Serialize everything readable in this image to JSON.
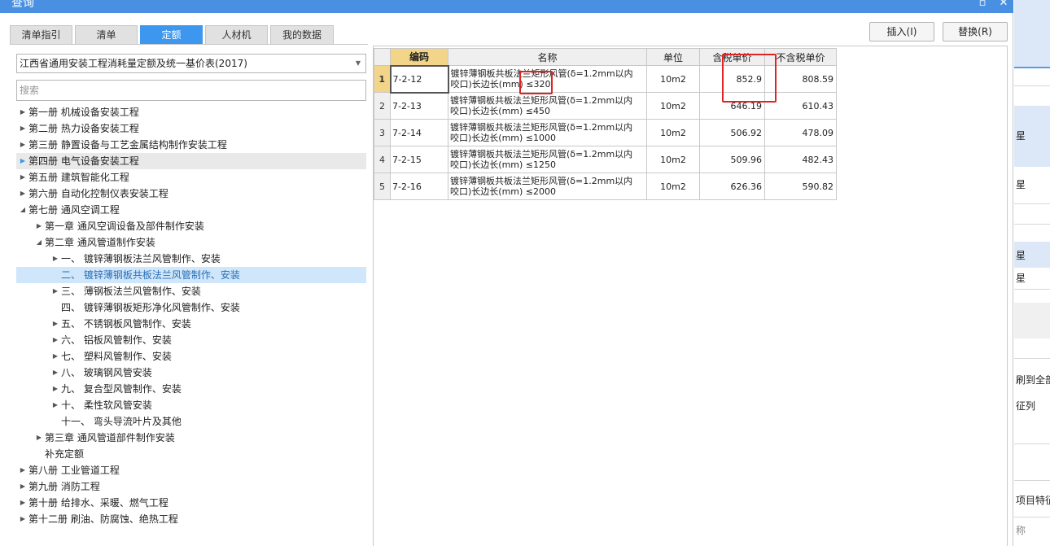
{
  "window": {
    "title": "查询",
    "maximize_glyph": "▫",
    "close_glyph": "✕"
  },
  "tabs": [
    {
      "label": "清单指引",
      "active": false
    },
    {
      "label": "清单",
      "active": false
    },
    {
      "label": "定额",
      "active": true
    },
    {
      "label": "人材机",
      "active": false
    },
    {
      "label": "我的数据",
      "active": false
    }
  ],
  "library_select": {
    "value": "江西省通用安装工程消耗量定额及统一基价表(2017)"
  },
  "search": {
    "placeholder": "搜索"
  },
  "tree": [
    {
      "label": "第一册 机械设备安装工程",
      "state": "collapsed"
    },
    {
      "label": "第二册 热力设备安装工程",
      "state": "collapsed"
    },
    {
      "label": "第三册 静置设备与工艺金属结构制作安装工程",
      "state": "collapsed"
    },
    {
      "label": "第四册 电气设备安装工程",
      "state": "collapsed"
    },
    {
      "label": "第五册 建筑智能化工程",
      "state": "collapsed"
    },
    {
      "label": "第六册 自动化控制仪表安装工程",
      "state": "collapsed"
    },
    {
      "label": "第七册 通风空调工程",
      "state": "expanded"
    },
    {
      "label": "第一章 通风空调设备及部件制作安装",
      "state": "collapsed"
    },
    {
      "label": "第二章 通风管道制作安装",
      "state": "expanded"
    },
    {
      "label": "一、 镀锌薄钢板法兰风管制作、安装",
      "state": "collapsed"
    },
    {
      "label": "二、 镀锌薄钢板共板法兰风管制作、安装",
      "state": "none"
    },
    {
      "label": "三、 薄钢板法兰风管制作、安装",
      "state": "collapsed"
    },
    {
      "label": "四、 镀锌薄钢板矩形净化风管制作、安装",
      "state": "none"
    },
    {
      "label": "五、 不锈钢板风管制作、安装",
      "state": "collapsed"
    },
    {
      "label": "六、 铝板风管制作、安装",
      "state": "collapsed"
    },
    {
      "label": "七、 塑料风管制作、安装",
      "state": "collapsed"
    },
    {
      "label": "八、 玻璃钢风管安装",
      "state": "collapsed"
    },
    {
      "label": "九、 复合型风管制作、安装",
      "state": "collapsed"
    },
    {
      "label": "十、 柔性软风管安装",
      "state": "collapsed"
    },
    {
      "label": "十一、 弯头导流叶片及其他",
      "state": "none"
    },
    {
      "label": "第三章 通风管道部件制作安装",
      "state": "collapsed"
    },
    {
      "label": "补充定额",
      "state": "none"
    },
    {
      "label": "第八册 工业管道工程",
      "state": "collapsed"
    },
    {
      "label": "第九册 消防工程",
      "state": "collapsed"
    },
    {
      "label": "第十册 给排水、采暖、燃气工程",
      "state": "collapsed"
    },
    {
      "label": "第十二册 刷油、防腐蚀、绝热工程",
      "state": "collapsed"
    }
  ],
  "buttons": {
    "insert": "插入(I)",
    "replace": "替换(R)"
  },
  "grid": {
    "headers": {
      "code": "编码",
      "name": "名称",
      "unit": "单位",
      "price_tax": "含税单价",
      "price_notax": "不含税单价"
    },
    "rows": [
      {
        "num": "1",
        "code": "7-2-12",
        "name_line1": "镀锌薄钢板共板法兰矩形风管(δ=1.2mm以内",
        "name_line2": "咬口)长边长(mm) ≤320",
        "unit": "10m2",
        "price_tax": "852.9",
        "price_notax": "808.59"
      },
      {
        "num": "2",
        "code": "7-2-13",
        "name_line1": "镀锌薄钢板共板法兰矩形风管(δ=1.2mm以内",
        "name_line2": "咬口)长边长(mm) ≤450",
        "unit": "10m2",
        "price_tax": "646.19",
        "price_notax": "610.43"
      },
      {
        "num": "3",
        "code": "7-2-14",
        "name_line1": "镀锌薄钢板共板法兰矩形风管(δ=1.2mm以内",
        "name_line2": "咬口)长边长(mm) ≤1000",
        "unit": "10m2",
        "price_tax": "506.92",
        "price_notax": "478.09"
      },
      {
        "num": "4",
        "code": "7-2-15",
        "name_line1": "镀锌薄钢板共板法兰矩形风管(δ=1.2mm以内",
        "name_line2": "咬口)长边长(mm) ≤1250",
        "unit": "10m2",
        "price_tax": "509.96",
        "price_notax": "482.43"
      },
      {
        "num": "5",
        "code": "7-2-16",
        "name_line1": "镀锌薄钢板共板法兰矩形风管(δ=1.2mm以内",
        "name_line2": "咬口)长边长(mm) ≤2000",
        "unit": "10m2",
        "price_tax": "626.36",
        "price_notax": "590.82"
      }
    ]
  },
  "background_app": {
    "fragments": [
      "星",
      "星",
      "星",
      "星",
      "刷到全部",
      "征列",
      "项目特征",
      "称"
    ]
  },
  "colors": {
    "accent": "#3d97ef",
    "titlebar": "#4a90e2",
    "highlight": "#e02424",
    "selected_header": "#f3d58a"
  }
}
